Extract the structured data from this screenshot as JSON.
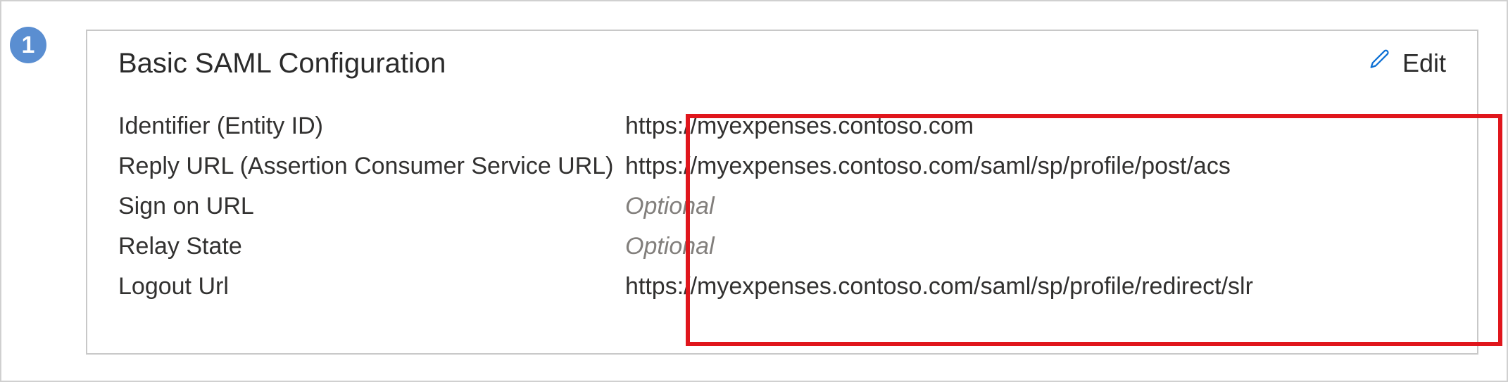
{
  "step": {
    "number": "1"
  },
  "card": {
    "title": "Basic SAML Configuration",
    "edit_label": "Edit",
    "fields": {
      "identifier": {
        "label": "Identifier (Entity ID)",
        "value": "https://myexpenses.contoso.com",
        "optional": false
      },
      "reply_url": {
        "label": "Reply URL (Assertion Consumer Service URL)",
        "value": "https://myexpenses.contoso.com/saml/sp/profile/post/acs",
        "optional": false
      },
      "sign_on_url": {
        "label": "Sign on URL",
        "value": "Optional",
        "optional": true
      },
      "relay_state": {
        "label": "Relay State",
        "value": "Optional",
        "optional": true
      },
      "logout_url": {
        "label": "Logout Url",
        "value": "https://myexpenses.contoso.com/saml/sp/profile/redirect/slr",
        "optional": false
      }
    }
  }
}
